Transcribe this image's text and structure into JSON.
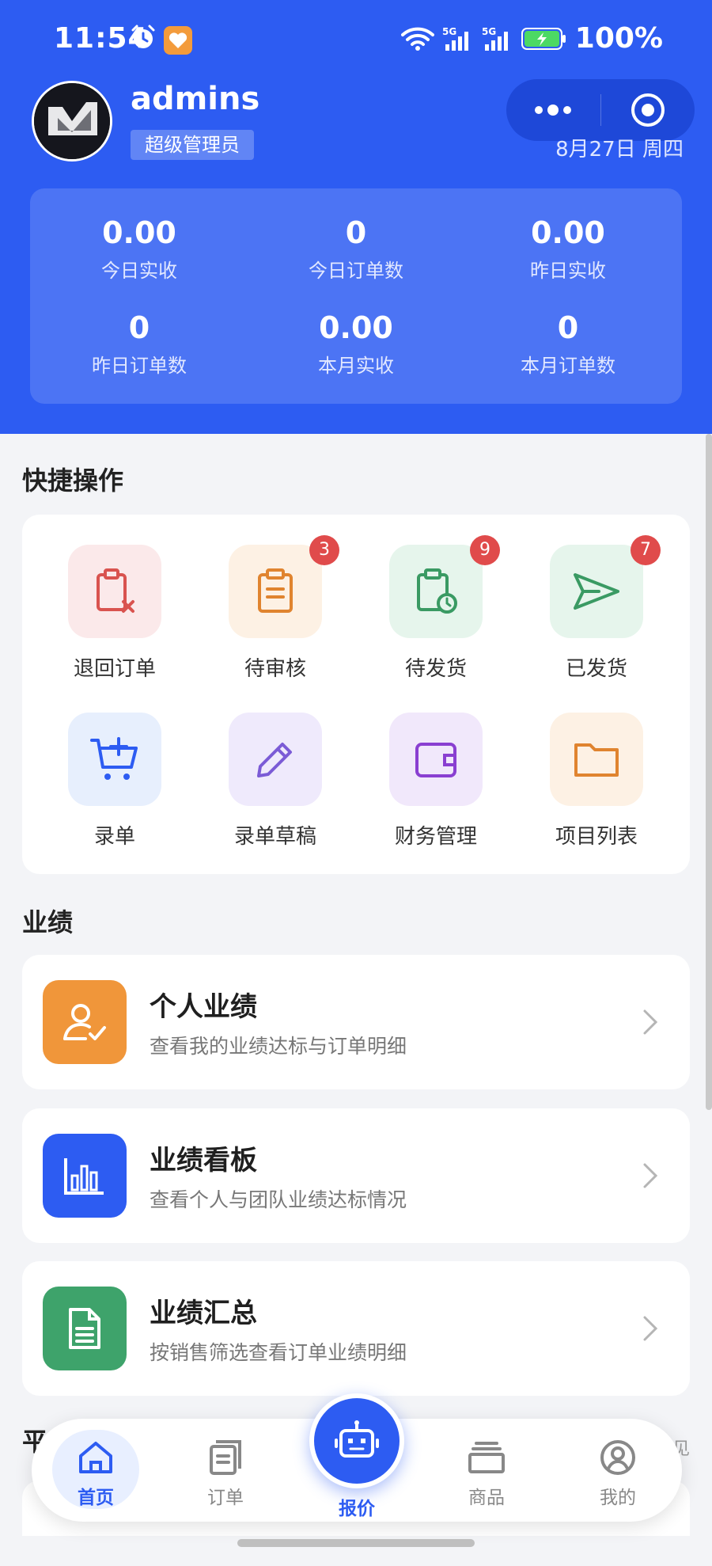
{
  "status_bar": {
    "time": "11:54",
    "battery": "100%",
    "network": "5G"
  },
  "header": {
    "username": "admins",
    "role": "超级管理员",
    "date": "8月27日 周四",
    "menu_icon": "more-dots-icon",
    "close_icon": "target-circle-icon"
  },
  "stats": [
    {
      "value": "0.00",
      "label": "今日实收"
    },
    {
      "value": "0",
      "label": "今日订单数"
    },
    {
      "value": "0.00",
      "label": "昨日实收"
    },
    {
      "value": "0",
      "label": "昨日订单数"
    },
    {
      "value": "0.00",
      "label": "本月实收"
    },
    {
      "value": "0",
      "label": "本月订单数"
    }
  ],
  "quick": {
    "title": "快捷操作",
    "items": [
      {
        "label": "退回订单",
        "icon": "clipboard-x-icon",
        "badge": ""
      },
      {
        "label": "待审核",
        "icon": "clipboard-list-icon",
        "badge": "3"
      },
      {
        "label": "待发货",
        "icon": "clipboard-clock-icon",
        "badge": "9"
      },
      {
        "label": "已发货",
        "icon": "send-icon",
        "badge": "7"
      },
      {
        "label": "录单",
        "icon": "cart-plus-icon",
        "badge": ""
      },
      {
        "label": "录单草稿",
        "icon": "pencil-icon",
        "badge": ""
      },
      {
        "label": "财务管理",
        "icon": "wallet-icon",
        "badge": ""
      },
      {
        "label": "项目列表",
        "icon": "folder-icon",
        "badge": ""
      }
    ]
  },
  "performance": {
    "title": "业绩",
    "items": [
      {
        "title": "个人业绩",
        "subtitle": "查看我的业绩达标与订单明细",
        "icon": "user-check-icon",
        "color": "#f0963a"
      },
      {
        "title": "业绩看板",
        "subtitle": "查看个人与团队业绩达标情况",
        "icon": "bar-chart-icon",
        "color": "#2d5cf2"
      },
      {
        "title": "业绩汇总",
        "subtitle": "按销售筛选查看订单业绩明细",
        "icon": "document-icon",
        "color": "#3ea36b"
      }
    ]
  },
  "partial": {
    "title": "平",
    "right": "见"
  },
  "tabbar": {
    "items": [
      {
        "label": "首页",
        "icon": "home-icon"
      },
      {
        "label": "订单",
        "icon": "orders-icon"
      },
      {
        "label": "报价",
        "icon": "robot-icon"
      },
      {
        "label": "商品",
        "icon": "goods-icon"
      },
      {
        "label": "我的",
        "icon": "user-circle-icon"
      }
    ]
  },
  "colors": {
    "primary": "#2d5cf2",
    "badge": "#e04b4b"
  }
}
